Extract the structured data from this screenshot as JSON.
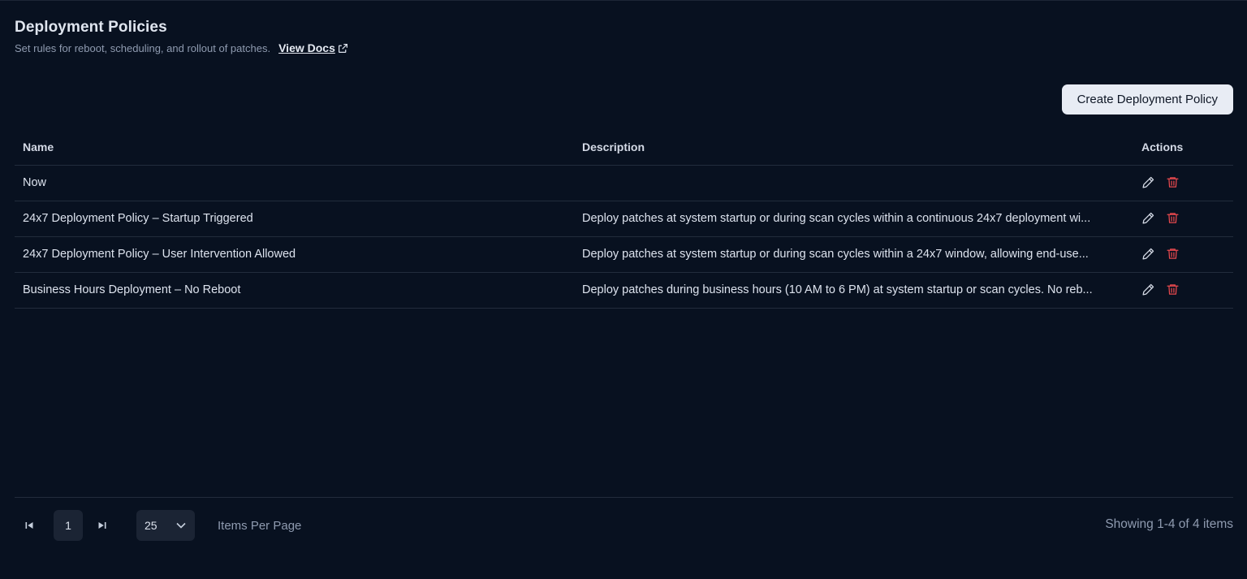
{
  "header": {
    "title": "Deployment Policies",
    "subtitle": "Set rules for reboot, scheduling, and rollout of patches.",
    "docs_link": "View Docs"
  },
  "toolbar": {
    "create_label": "Create Deployment Policy"
  },
  "table": {
    "columns": [
      "Name",
      "Description",
      "Actions"
    ],
    "rows": [
      {
        "name": "Now",
        "description": ""
      },
      {
        "name": "24x7 Deployment Policy – Startup Triggered",
        "description": "Deploy patches at system startup or during scan cycles within a continuous 24x7 deployment wi..."
      },
      {
        "name": "24x7 Deployment Policy – User Intervention Allowed",
        "description": "Deploy patches at system startup or during scan cycles within a 24x7 window, allowing end-use..."
      },
      {
        "name": "Business Hours Deployment – No Reboot",
        "description": "Deploy patches during business hours (10 AM to 6 PM) at system startup or scan cycles. No reb..."
      }
    ],
    "actions": {
      "edit_icon": "pencil-icon",
      "delete_icon": "trash-icon"
    }
  },
  "pagination": {
    "current_page": "1",
    "per_page": "25",
    "per_page_label": "Items Per Page",
    "showing": "Showing 1-4 of 4 items"
  },
  "colors": {
    "background": "#081120",
    "delete": "#e5484d",
    "button_bg": "#e8ecf4"
  }
}
